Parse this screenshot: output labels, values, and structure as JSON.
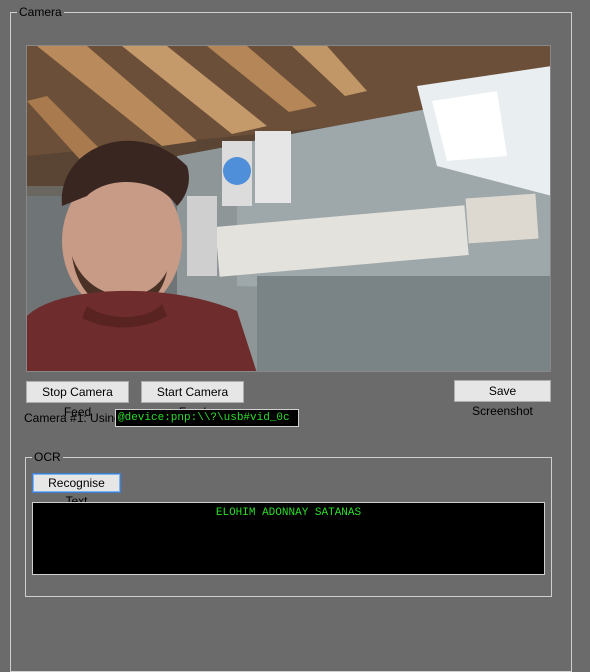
{
  "camera_group": {
    "title": "Camera"
  },
  "camera": {
    "feed_alt": "Live webcam feed",
    "stop_label": "Stop Camera Feed",
    "start_label": "Start Camera Feed",
    "save_label": "Save Screenshot",
    "device_label": "Camera #1: Using",
    "device_value": "@device:pnp:\\\\?\\usb#vid_0c"
  },
  "ocr_group": {
    "title": "OCR",
    "recognise_label": "Recognise Text",
    "output_text": "ELOHIM ADONNAY SATANAS"
  },
  "colors": {
    "window_bg": "#6b6b6b",
    "terminal_bg": "#000000",
    "terminal_text": "#2bdc2b",
    "button_bg": "#e6e6e6",
    "focus_border": "#3c7fd1"
  }
}
